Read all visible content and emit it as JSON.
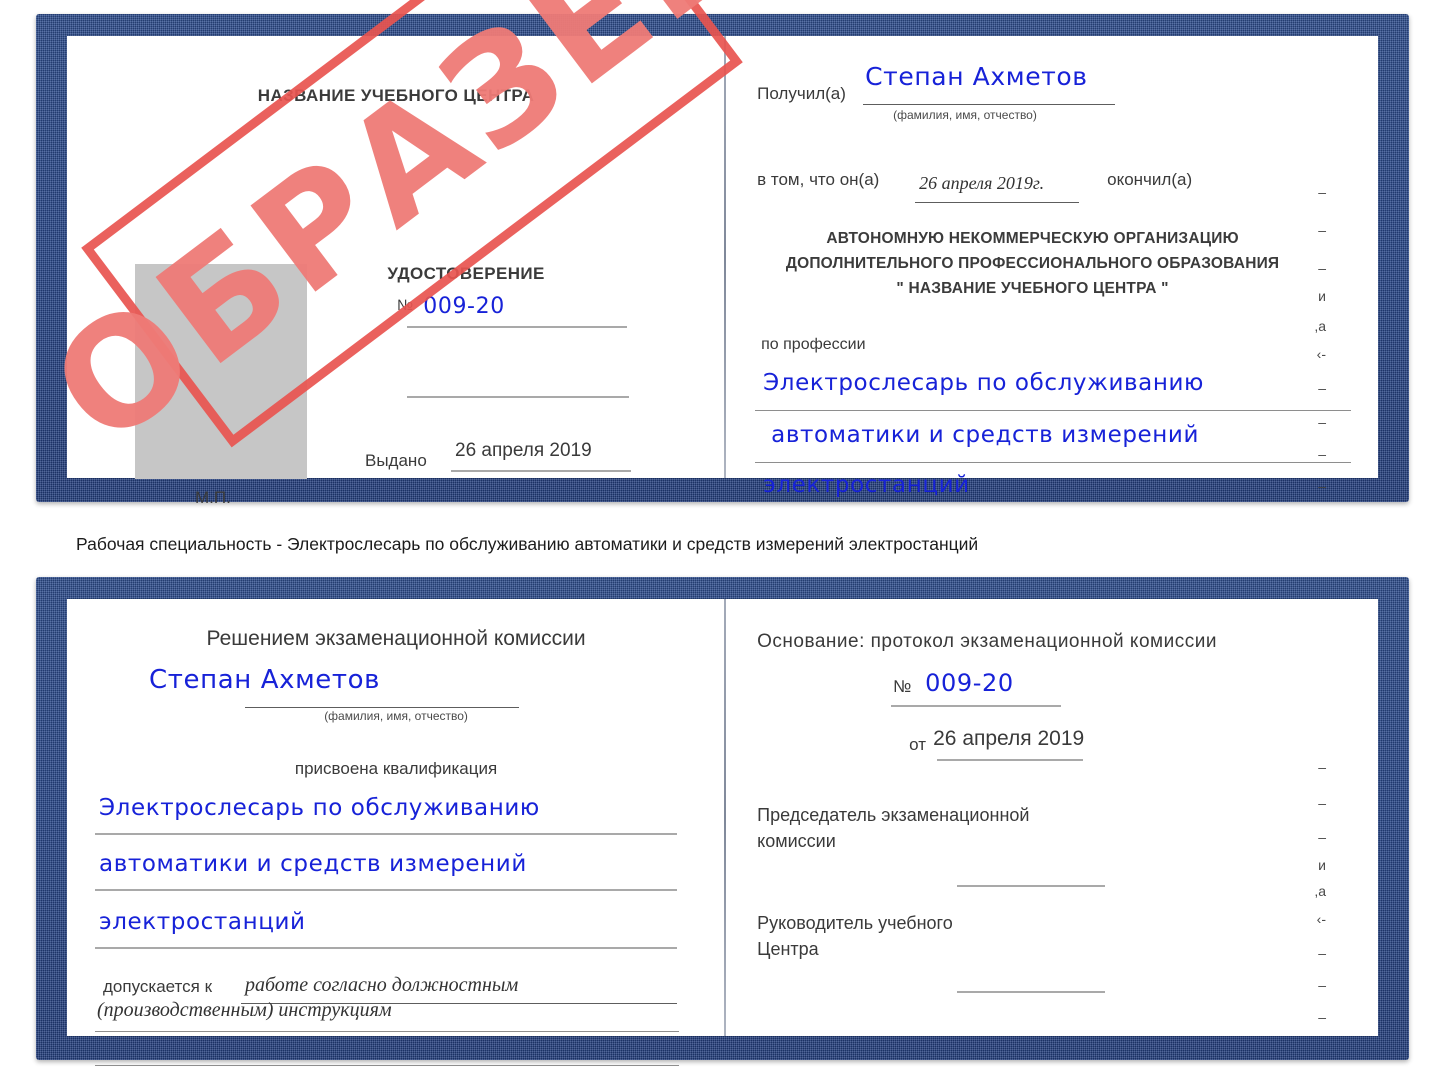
{
  "document": {
    "kind": "Удостоверение",
    "watermark": "ОБРАЗЕЦ",
    "colors": {
      "cover": "#2d4d8e",
      "watermark": "#e8544f",
      "handwriting": "#1722d8",
      "photo_placeholder": "#c6c6c6"
    }
  },
  "caption": {
    "text": "Рабочая специальность - Электрослесарь по обслуживанию автоматики и средств измерений электростанций"
  },
  "top_certificate": {
    "left_page": {
      "center_name": "НАЗВАНИЕ УЧЕБНОГО ЦЕНТРА",
      "photo_label": "",
      "seal_label": "М.П.",
      "title": "УДОСТОВЕРЕНИЕ",
      "number_symbol": "№",
      "number_value": "009-20",
      "issued_label": "Выдано",
      "issued_value": "26 апреля 2019"
    },
    "right_page": {
      "received_label": "Получил(а)",
      "received_value": "Степан Ахметов",
      "fio_hint": "(фамилия, имя, отчество)",
      "in_that_label": "в том, что он(а)",
      "completion_date": "26 апреля 2019г.",
      "finished_label": "окончил(а)",
      "organization_lines": [
        "АВТОНОМНУЮ НЕКОММЕРЧЕСКУЮ ОРГАНИЗАЦИЮ",
        "ДОПОЛНИТЕЛЬНОГО ПРОФЕССИОНАЛЬНОГО ОБРАЗОВАНИЯ",
        "\"    НАЗВАНИЕ УЧЕБНОГО ЦЕНТРА           \""
      ],
      "profession_label": "по профессии",
      "profession_lines": [
        "Электрослесарь по обслуживанию",
        "автоматики и средств измерений",
        "электростанций"
      ],
      "edge_fragments": [
        "–",
        "–",
        "–",
        "–",
        "и",
        ",а",
        "‹-",
        "–",
        "–",
        "–",
        "–"
      ]
    }
  },
  "bottom_certificate": {
    "left_page": {
      "heading": "Решением экзаменационной комиссии",
      "name_value": "Степан Ахметов",
      "fio_hint": "(фамилия, имя, отчество)",
      "qualification_label": "присвоена квалификация",
      "qualification_lines": [
        "Электрослесарь по обслуживанию",
        "автоматики и средств измерений",
        "электростанций"
      ],
      "admitted_label": "допускается к",
      "admitted_value_line1": "работе согласно должностным",
      "admitted_value_line2": "(производственным) инструкциям"
    },
    "right_page": {
      "basis_label": "Основание: протокол экзаменационной комиссии",
      "number_symbol": "№",
      "number_value": "009-20",
      "date_prefix": "от",
      "date_value": "26 апреля 2019",
      "chairman_line1": "Председатель экзаменационной",
      "chairman_line2": "комиссии",
      "head_line1": "Руководитель учебного",
      "head_line2": "Центра",
      "edge_fragments": [
        "–",
        "–",
        "–",
        "и",
        ",а",
        "‹-",
        "–",
        "–",
        "–"
      ]
    }
  }
}
